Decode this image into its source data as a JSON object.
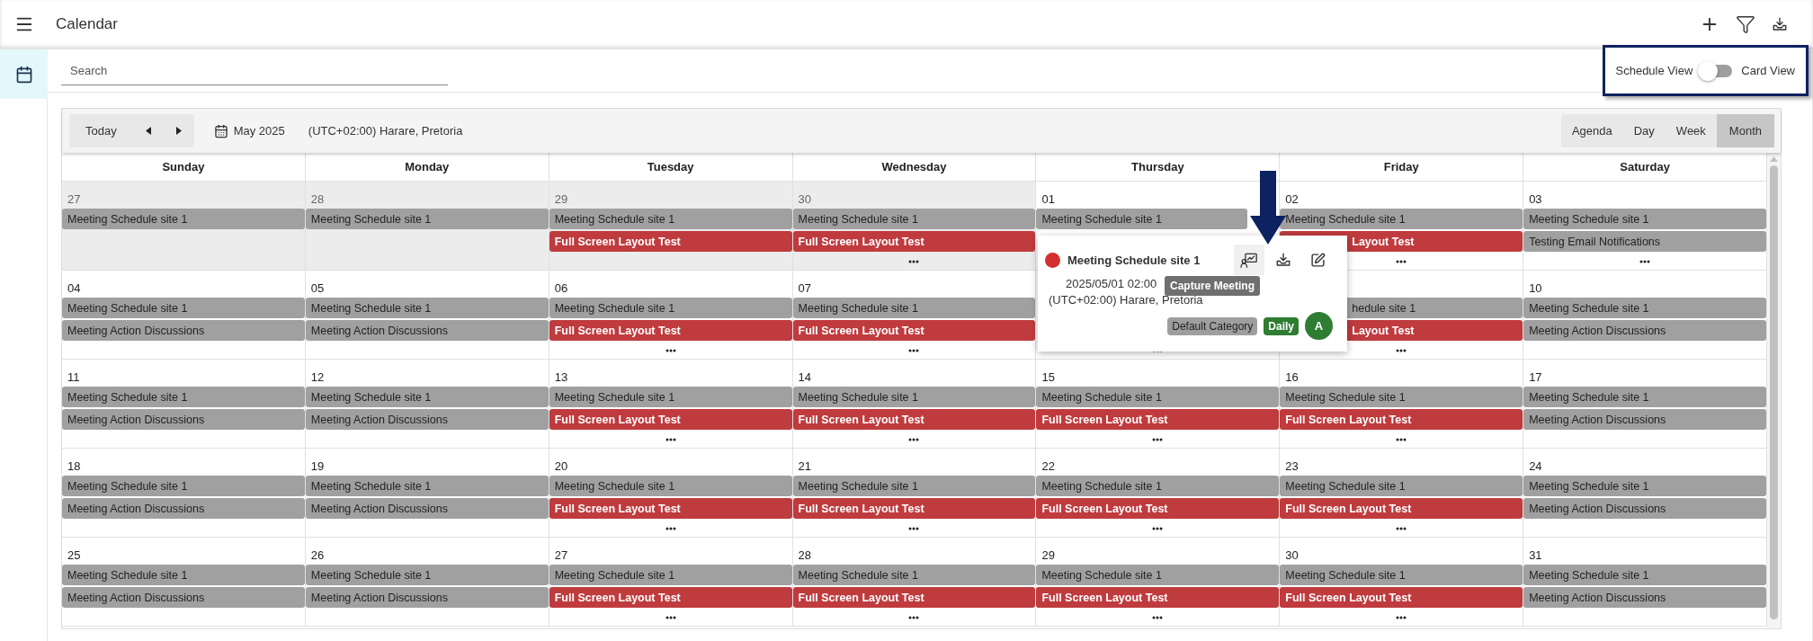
{
  "app_bar": {
    "title": "Calendar"
  },
  "sidebar": {
    "items": [
      {
        "selected": true
      }
    ]
  },
  "search": {
    "placeholder": "Search"
  },
  "view_toggle": {
    "left_label": "Schedule View",
    "right_label": "Card View",
    "on": false
  },
  "toolbar": {
    "today": "Today",
    "month": "May 2025",
    "timezone": "(UTC+02:00) Harare, Pretoria",
    "views": [
      {
        "label": "Agenda",
        "selected": false
      },
      {
        "label": "Day",
        "selected": false
      },
      {
        "label": "Week",
        "selected": false
      },
      {
        "label": "Month",
        "selected": true
      }
    ]
  },
  "weekdays": [
    "Sunday",
    "Monday",
    "Tuesday",
    "Wednesday",
    "Thursday",
    "Friday",
    "Saturday"
  ],
  "weeks": [
    {
      "days": [
        {
          "day": "27",
          "other_month": true,
          "more": false,
          "events": [
            {
              "title": "Meeting Schedule site 1",
              "color": "#a0a0a0"
            }
          ]
        },
        {
          "day": "28",
          "other_month": true,
          "more": false,
          "events": [
            {
              "title": "Meeting Schedule site 1",
              "color": "#a0a0a0"
            }
          ]
        },
        {
          "day": "29",
          "other_month": true,
          "more": false,
          "events": [
            {
              "title": "Meeting Schedule site 1",
              "color": "#a0a0a0"
            },
            {
              "title": "Full Screen Layout Test",
              "color": "#bf3b3e"
            }
          ]
        },
        {
          "day": "30",
          "other_month": true,
          "more": true,
          "events": [
            {
              "title": "Meeting Schedule site 1",
              "color": "#a0a0a0"
            },
            {
              "title": "Full Screen Layout Test",
              "color": "#bf3b3e"
            }
          ]
        },
        {
          "day": "01",
          "other_month": false,
          "events": [
            {
              "title": "Meeting Schedule site 1",
              "color": "#a0a0a0",
              "short": true
            }
          ]
        },
        {
          "day": "02",
          "other_month": false,
          "more": true,
          "events": [
            {
              "title": "Meeting Schedule site 1",
              "color": "#a0a0a0"
            },
            {
              "title": "Layout Test",
              "color": "#bf3b3e",
              "partial": true
            }
          ]
        },
        {
          "day": "03",
          "other_month": false,
          "more": true,
          "events": [
            {
              "title": "Meeting Schedule site 1",
              "color": "#a0a0a0"
            },
            {
              "title": "Testing Email Notifications",
              "color": "#a0a0a0"
            }
          ]
        }
      ]
    },
    {
      "days": [
        {
          "day": "04",
          "other_month": false,
          "more": false,
          "events": [
            {
              "title": "Meeting Schedule site 1",
              "color": "#a0a0a0"
            },
            {
              "title": "Meeting Action Discussions",
              "color": "#a0a0a0"
            }
          ]
        },
        {
          "day": "05",
          "other_month": false,
          "more": false,
          "events": [
            {
              "title": "Meeting Schedule site 1",
              "color": "#a0a0a0"
            },
            {
              "title": "Meeting Action Discussions",
              "color": "#a0a0a0"
            }
          ]
        },
        {
          "day": "06",
          "other_month": false,
          "more": true,
          "events": [
            {
              "title": "Meeting Schedule site 1",
              "color": "#a0a0a0"
            },
            {
              "title": "Full Screen Layout Test",
              "color": "#bf3b3e"
            }
          ]
        },
        {
          "day": "07",
          "other_month": false,
          "more": true,
          "events": [
            {
              "title": "Meeting Schedule site 1",
              "color": "#a0a0a0"
            },
            {
              "title": "Full Screen Layout Test",
              "color": "#bf3b3e"
            }
          ]
        },
        {
          "other_month": false,
          "more": true
        },
        {
          "other_month": false,
          "more": true,
          "events": [
            {
              "title": "hedule site 1",
              "color": "#a0a0a0",
              "partial": true
            },
            {
              "title": "Layout Test",
              "color": "#bf3b3e",
              "partial": true
            }
          ]
        },
        {
          "day": "10",
          "other_month": false,
          "more": false,
          "events": [
            {
              "title": "Meeting Schedule site 1",
              "color": "#a0a0a0"
            },
            {
              "title": "Meeting Action Discussions",
              "color": "#a0a0a0"
            }
          ]
        }
      ]
    },
    {
      "days": [
        {
          "day": "11",
          "other_month": false,
          "more": false,
          "events": [
            {
              "title": "Meeting Schedule site 1",
              "color": "#a0a0a0"
            },
            {
              "title": "Meeting Action Discussions",
              "color": "#a0a0a0"
            }
          ]
        },
        {
          "day": "12",
          "other_month": false,
          "more": false,
          "events": [
            {
              "title": "Meeting Schedule site 1",
              "color": "#a0a0a0"
            },
            {
              "title": "Meeting Action Discussions",
              "color": "#a0a0a0"
            }
          ]
        },
        {
          "day": "13",
          "other_month": false,
          "more": true,
          "events": [
            {
              "title": "Meeting Schedule site 1",
              "color": "#a0a0a0"
            },
            {
              "title": "Full Screen Layout Test",
              "color": "#bf3b3e"
            }
          ]
        },
        {
          "day": "14",
          "other_month": false,
          "more": true,
          "events": [
            {
              "title": "Meeting Schedule site 1",
              "color": "#a0a0a0"
            },
            {
              "title": "Full Screen Layout Test",
              "color": "#bf3b3e"
            }
          ]
        },
        {
          "day": "15",
          "other_month": false,
          "more": true,
          "events": [
            {
              "title": "Meeting Schedule site 1",
              "color": "#a0a0a0"
            },
            {
              "title": "Full Screen Layout Test",
              "color": "#bf3b3e"
            }
          ]
        },
        {
          "day": "16",
          "other_month": false,
          "more": true,
          "events": [
            {
              "title": "Meeting Schedule site 1",
              "color": "#a0a0a0"
            },
            {
              "title": "Full Screen Layout Test",
              "color": "#bf3b3e"
            }
          ]
        },
        {
          "day": "17",
          "other_month": false,
          "more": false,
          "events": [
            {
              "title": "Meeting Schedule site 1",
              "color": "#a0a0a0"
            },
            {
              "title": "Meeting Action Discussions",
              "color": "#a0a0a0"
            }
          ]
        }
      ]
    },
    {
      "days": [
        {
          "day": "18",
          "other_month": false,
          "more": false,
          "events": [
            {
              "title": "Meeting Schedule site 1",
              "color": "#a0a0a0"
            },
            {
              "title": "Meeting Action Discussions",
              "color": "#a0a0a0"
            }
          ]
        },
        {
          "day": "19",
          "other_month": false,
          "more": false,
          "events": [
            {
              "title": "Meeting Schedule site 1",
              "color": "#a0a0a0"
            },
            {
              "title": "Meeting Action Discussions",
              "color": "#a0a0a0"
            }
          ]
        },
        {
          "day": "20",
          "other_month": false,
          "more": true,
          "events": [
            {
              "title": "Meeting Schedule site 1",
              "color": "#a0a0a0"
            },
            {
              "title": "Full Screen Layout Test",
              "color": "#bf3b3e"
            }
          ]
        },
        {
          "day": "21",
          "other_month": false,
          "more": true,
          "events": [
            {
              "title": "Meeting Schedule site 1",
              "color": "#a0a0a0"
            },
            {
              "title": "Full Screen Layout Test",
              "color": "#bf3b3e"
            }
          ]
        },
        {
          "day": "22",
          "other_month": false,
          "more": true,
          "events": [
            {
              "title": "Meeting Schedule site 1",
              "color": "#a0a0a0"
            },
            {
              "title": "Full Screen Layout Test",
              "color": "#bf3b3e"
            }
          ]
        },
        {
          "day": "23",
          "other_month": false,
          "more": true,
          "events": [
            {
              "title": "Meeting Schedule site 1",
              "color": "#a0a0a0"
            },
            {
              "title": "Full Screen Layout Test",
              "color": "#bf3b3e"
            }
          ]
        },
        {
          "day": "24",
          "other_month": false,
          "more": false,
          "events": [
            {
              "title": "Meeting Schedule site 1",
              "color": "#a0a0a0"
            },
            {
              "title": "Meeting Action Discussions",
              "color": "#a0a0a0"
            }
          ]
        }
      ]
    },
    {
      "days": [
        {
          "day": "25",
          "other_month": false,
          "more": false,
          "events": [
            {
              "title": "Meeting Schedule site 1",
              "color": "#a0a0a0"
            },
            {
              "title": "Meeting Action Discussions",
              "color": "#a0a0a0"
            }
          ]
        },
        {
          "day": "26",
          "other_month": false,
          "more": false,
          "events": [
            {
              "title": "Meeting Schedule site 1",
              "color": "#a0a0a0"
            },
            {
              "title": "Meeting Action Discussions",
              "color": "#a0a0a0"
            }
          ]
        },
        {
          "day": "27",
          "other_month": false,
          "more": true,
          "events": [
            {
              "title": "Meeting Schedule site 1",
              "color": "#a0a0a0"
            },
            {
              "title": "Full Screen Layout Test",
              "color": "#bf3b3e"
            }
          ]
        },
        {
          "day": "28",
          "other_month": false,
          "more": true,
          "events": [
            {
              "title": "Meeting Schedule site 1",
              "color": "#a0a0a0"
            },
            {
              "title": "Full Screen Layout Test",
              "color": "#bf3b3e"
            }
          ]
        },
        {
          "day": "29",
          "other_month": false,
          "more": true,
          "events": [
            {
              "title": "Meeting Schedule site 1",
              "color": "#a0a0a0"
            },
            {
              "title": "Full Screen Layout Test",
              "color": "#bf3b3e"
            }
          ]
        },
        {
          "day": "30",
          "other_month": false,
          "more": true,
          "events": [
            {
              "title": "Meeting Schedule site 1",
              "color": "#a0a0a0"
            },
            {
              "title": "Full Screen Layout Test",
              "color": "#bf3b3e"
            }
          ]
        },
        {
          "day": "31",
          "other_month": false,
          "more": false,
          "events": [
            {
              "title": "Meeting Schedule site 1",
              "color": "#a0a0a0"
            },
            {
              "title": "Meeting Action Discussions",
              "color": "#a0a0a0"
            }
          ]
        }
      ]
    }
  ],
  "popup": {
    "title": "Meeting Schedule site 1",
    "color": "#d32f2f",
    "time": "2025/05/01 02:00",
    "timezone": "(UTC+02:00) Harare, Pretoria",
    "tooltip": "Capture Meeting",
    "avatar": "A",
    "tags": [
      {
        "label": "Default Category",
        "color": "#9e9e9e"
      },
      {
        "label": "Daily",
        "color": "#2e7d32"
      }
    ]
  }
}
